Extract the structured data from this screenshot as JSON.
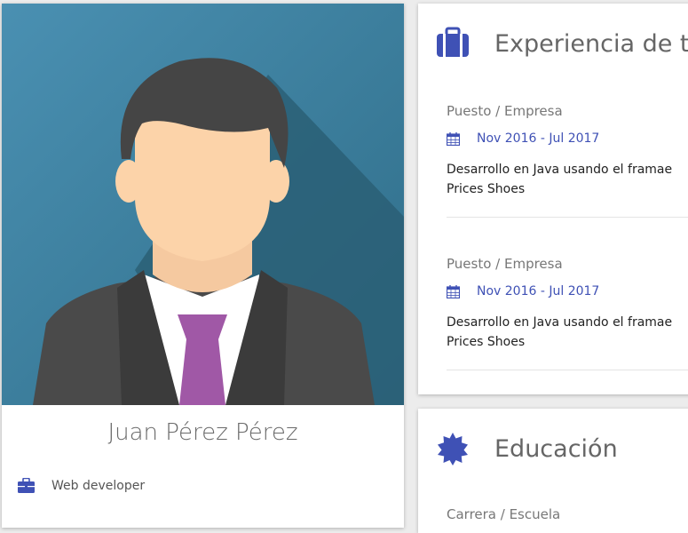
{
  "profile": {
    "name": "Juan Pérez Pérez",
    "role": "Web developer",
    "role_icon": "briefcase-icon"
  },
  "experience": {
    "title": "Experiencia de tr",
    "icon": "briefcase-icon",
    "entries": [
      {
        "position": "Puesto / Empresa",
        "dates": "Nov 2016 - Jul 2017",
        "desc_line1": "Desarrollo en Java usando el framae",
        "desc_line2": "Prices Shoes"
      },
      {
        "position": "Puesto / Empresa",
        "dates": "Nov 2016 - Jul 2017",
        "desc_line1": "Desarrollo en Java usando el framae",
        "desc_line2": "Prices Shoes"
      }
    ]
  },
  "education": {
    "title": "Educación",
    "icon": "seal-icon",
    "first_entry": "Carrera / Escuela"
  },
  "colors": {
    "accent": "#3f51b5",
    "avatar_bg": "#3f7f9c",
    "tie": "#a058a6"
  }
}
